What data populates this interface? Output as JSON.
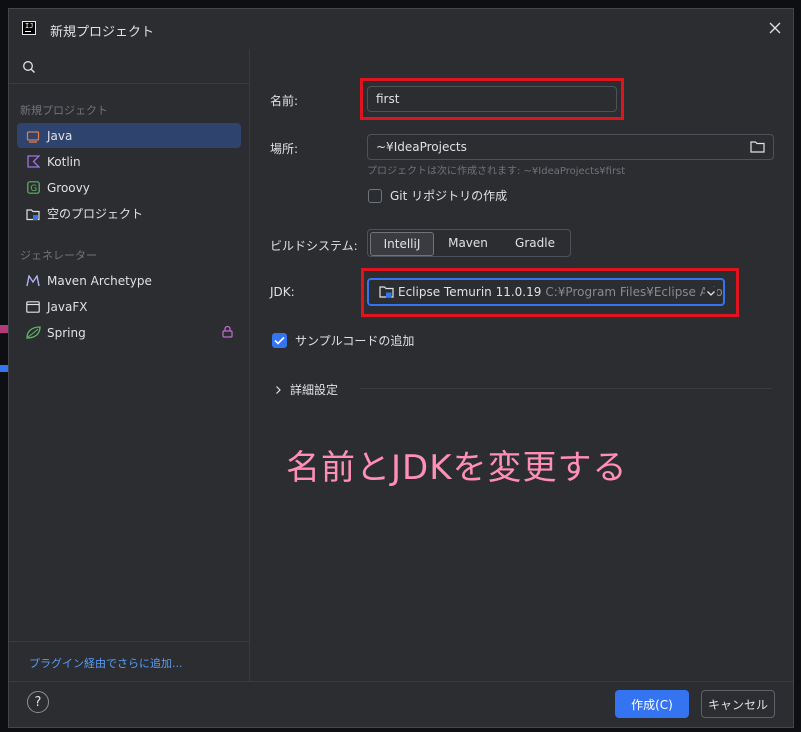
{
  "window": {
    "title": "新規プロジェクト",
    "logo": "IJ"
  },
  "sidebar": {
    "section1": "新規プロジェクト",
    "items": [
      {
        "label": "Java",
        "icon": "java-icon",
        "selected": true
      },
      {
        "label": "Kotlin",
        "icon": "kotlin-icon"
      },
      {
        "label": "Groovy",
        "icon": "groovy-icon"
      },
      {
        "label": "空のプロジェクト",
        "icon": "empty-project-icon"
      }
    ],
    "section2": "ジェネレーター",
    "generators": [
      {
        "label": "Maven Archetype",
        "icon": "maven-icon"
      },
      {
        "label": "JavaFX",
        "icon": "javafx-icon"
      },
      {
        "label": "Spring",
        "icon": "spring-icon",
        "locked": true
      }
    ],
    "plugin_link": "プラグイン経由でさらに追加..."
  },
  "form": {
    "name_label": "名前:",
    "name_value": "first",
    "location_label": "場所:",
    "location_value": "~¥IdeaProjects",
    "location_hint": "プロジェクトは次に作成されます: ~¥IdeaProjects¥first",
    "git_label": "Git リポジトリの作成",
    "git_checked": false,
    "build_label": "ビルドシステム:",
    "build_options": [
      "IntelliJ",
      "Maven",
      "Gradle"
    ],
    "build_selected": "IntelliJ",
    "jdk_label": "JDK:",
    "jdk_name": "Eclipse Temurin 11.0.19",
    "jdk_path": "C:¥Program Files¥Eclipse Adoptium",
    "sample_label": "サンプルコードの追加",
    "sample_checked": true,
    "advanced_label": "詳細設定"
  },
  "annotation": "名前とJDKを変更する",
  "buttons": {
    "help": "?",
    "create": "作成(C)",
    "cancel": "キャンセル"
  },
  "colors": {
    "accent": "#3574f0",
    "highlight": "#e0141f",
    "annotation": "#ff8fb5",
    "background": "#2b2d30"
  }
}
